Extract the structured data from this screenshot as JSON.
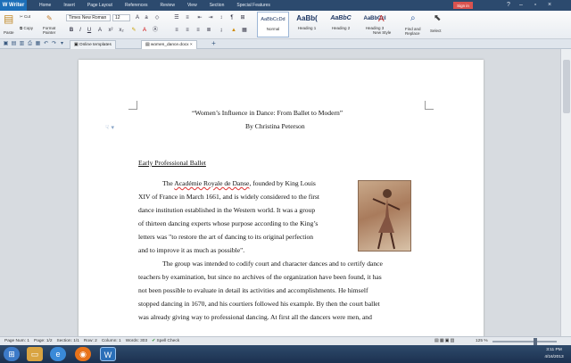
{
  "menubar": {
    "app_button": "W Writer",
    "items": [
      "Home",
      "Insert",
      "Page Layout",
      "References",
      "Review",
      "View",
      "Section",
      "Special Features"
    ],
    "signin": "Sign in"
  },
  "ribbon": {
    "paste": "Paste",
    "cut": "Cut",
    "copy": "Copy",
    "format_painter": "Format Painter",
    "font_name": "Times New Roman",
    "font_size": "12",
    "styles": [
      {
        "sample": "AaBbCcDd",
        "name": "Normal"
      },
      {
        "sample": "AaBb(",
        "name": "Heading 1"
      },
      {
        "sample": "AaBbC",
        "name": "Heading 2"
      },
      {
        "sample": "AaBbCcI",
        "name": "Heading 3"
      }
    ],
    "new_style": "New Style",
    "find_replace": "Find and Replace",
    "select": "Select"
  },
  "tabs": [
    {
      "label": "Online templates"
    },
    {
      "label": "women_dance.docx"
    }
  ],
  "document": {
    "title": "“Women’s Influence in Dance: From Ballet to Modern”",
    "byline": "By Christina Peterson",
    "heading": "Early Professional Ballet",
    "p1_l1a": "The ",
    "p1_l1b": "Académie Royale de Danse",
    "p1_l1c": ", founded by King Louis",
    "p1_lines": [
      "XIV of France in March 1661, and is widely considered to the first",
      "dance institution established in the Western world. It was a group",
      "of thirteen dancing experts whose purpose according to the King’s",
      "letters was \"to restore the art of dancing to its original perfection",
      "and to improve it as much as possible\"."
    ],
    "p2_lines": [
      "The group was intended to codify court and character dances and to certify dance",
      "teachers by examination, but since no archives of the organization have been found, it has",
      "not been possible to evaluate in detail its activities and accomplishments. He himself",
      "stopped dancing in 1670, and his courtiers followed his example. By then the court ballet",
      "was already giving way to professional dancing. At first all the dancers were men, and"
    ]
  },
  "status": {
    "page_num": "Page Num: 1",
    "page": "Page: 1/2",
    "section": "Section: 1/1",
    "row": "Row: 2",
    "column": "Column: 1",
    "words": "Words: 303",
    "spell": "Spell Check",
    "zoom": "125 %"
  },
  "clock": {
    "time": "3:11 PM",
    "date": "4/16/2013"
  }
}
